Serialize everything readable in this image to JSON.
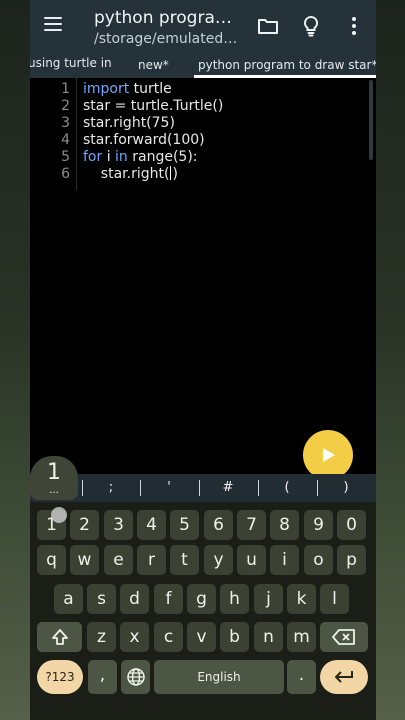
{
  "app": {
    "title": "python progra…",
    "subtitle": "/storage/emulated…",
    "icons": [
      "menu-icon",
      "folder-icon",
      "lightbulb-icon",
      "more-vert-icon"
    ]
  },
  "tabs": [
    {
      "label": "using turtle in"
    },
    {
      "label": "new*"
    },
    {
      "label": "python program to draw star*",
      "active": true
    }
  ],
  "editor": {
    "line_numbers": [
      "1",
      "2",
      "3",
      "4",
      "5",
      "6"
    ],
    "lines": [
      {
        "kw": "import",
        "rest": " turtle"
      },
      {
        "text": "star = turtle.Turtle()"
      },
      {
        "text": "star.right(75)"
      },
      {
        "text": "star.forward(100)"
      },
      {
        "kw": "for",
        "mid": " i ",
        "kw2": "in",
        "rest": " range(5):"
      },
      {
        "before": "    star.right(",
        "after": ")"
      }
    ]
  },
  "run_button": {
    "icon": "play-icon",
    "color": "#f2cd45"
  },
  "symbol_bar": [
    ":",
    ";",
    "'",
    "#",
    "(",
    ")"
  ],
  "keyboard": {
    "popup": {
      "char": "1",
      "dots": "..."
    },
    "row_numbers": [
      "1",
      "2",
      "3",
      "4",
      "5",
      "6",
      "7",
      "8",
      "9",
      "0"
    ],
    "row1": [
      "q",
      "w",
      "e",
      "r",
      "t",
      "y",
      "u",
      "i",
      "o",
      "p"
    ],
    "row2": [
      "a",
      "s",
      "d",
      "f",
      "g",
      "h",
      "j",
      "k",
      "l"
    ],
    "row3": [
      "z",
      "x",
      "c",
      "v",
      "b",
      "n",
      "m"
    ],
    "symbols_key": "?123",
    "comma": ",",
    "space": "English",
    "period": ".",
    "accent_color": "#f2d6a6"
  }
}
